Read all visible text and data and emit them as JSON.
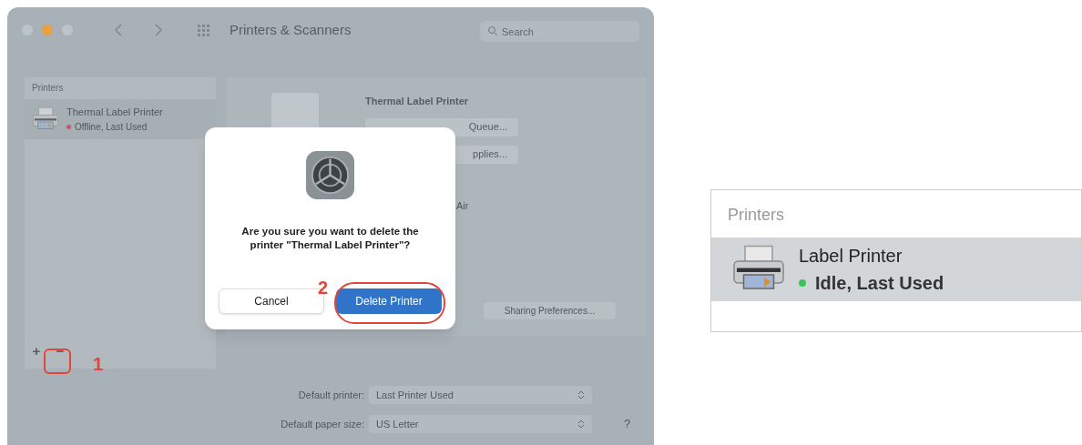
{
  "window": {
    "title": "Printers & Scanners",
    "search_placeholder": "Search"
  },
  "sidebar": {
    "header": "Printers",
    "printers": [
      {
        "name": "Thermal Label Printer",
        "status": "Offline, Last Used",
        "color": "#d8505a",
        "selected": true
      }
    ],
    "controls": [
      "+",
      "−"
    ]
  },
  "details": {
    "name": "Thermal Label Printer",
    "buttons": [
      "Queue...",
      "pplies..."
    ],
    "location": "Air",
    "sharing_button": "Sharing Preferences..."
  },
  "defaults": [
    {
      "label": "Default printer:",
      "value": "Last Printer Used"
    },
    {
      "label": "Default paper size:",
      "value": "US Letter"
    }
  ],
  "help": "?",
  "dialog": {
    "message": "Are you sure you want to delete the printer \"Thermal Label Printer\"?",
    "buttons": [
      {
        "label": "Cancel",
        "kind": "secondary"
      },
      {
        "label": "Delete Printer",
        "kind": "primary"
      }
    ]
  },
  "annotations": [
    {
      "label": "1"
    },
    {
      "label": "2"
    }
  ],
  "inset": {
    "header": "Printers",
    "printers": [
      {
        "name": "Label Printer",
        "status": "Idle, Last Used",
        "color": "#3cc45a",
        "selected": true
      }
    ]
  }
}
